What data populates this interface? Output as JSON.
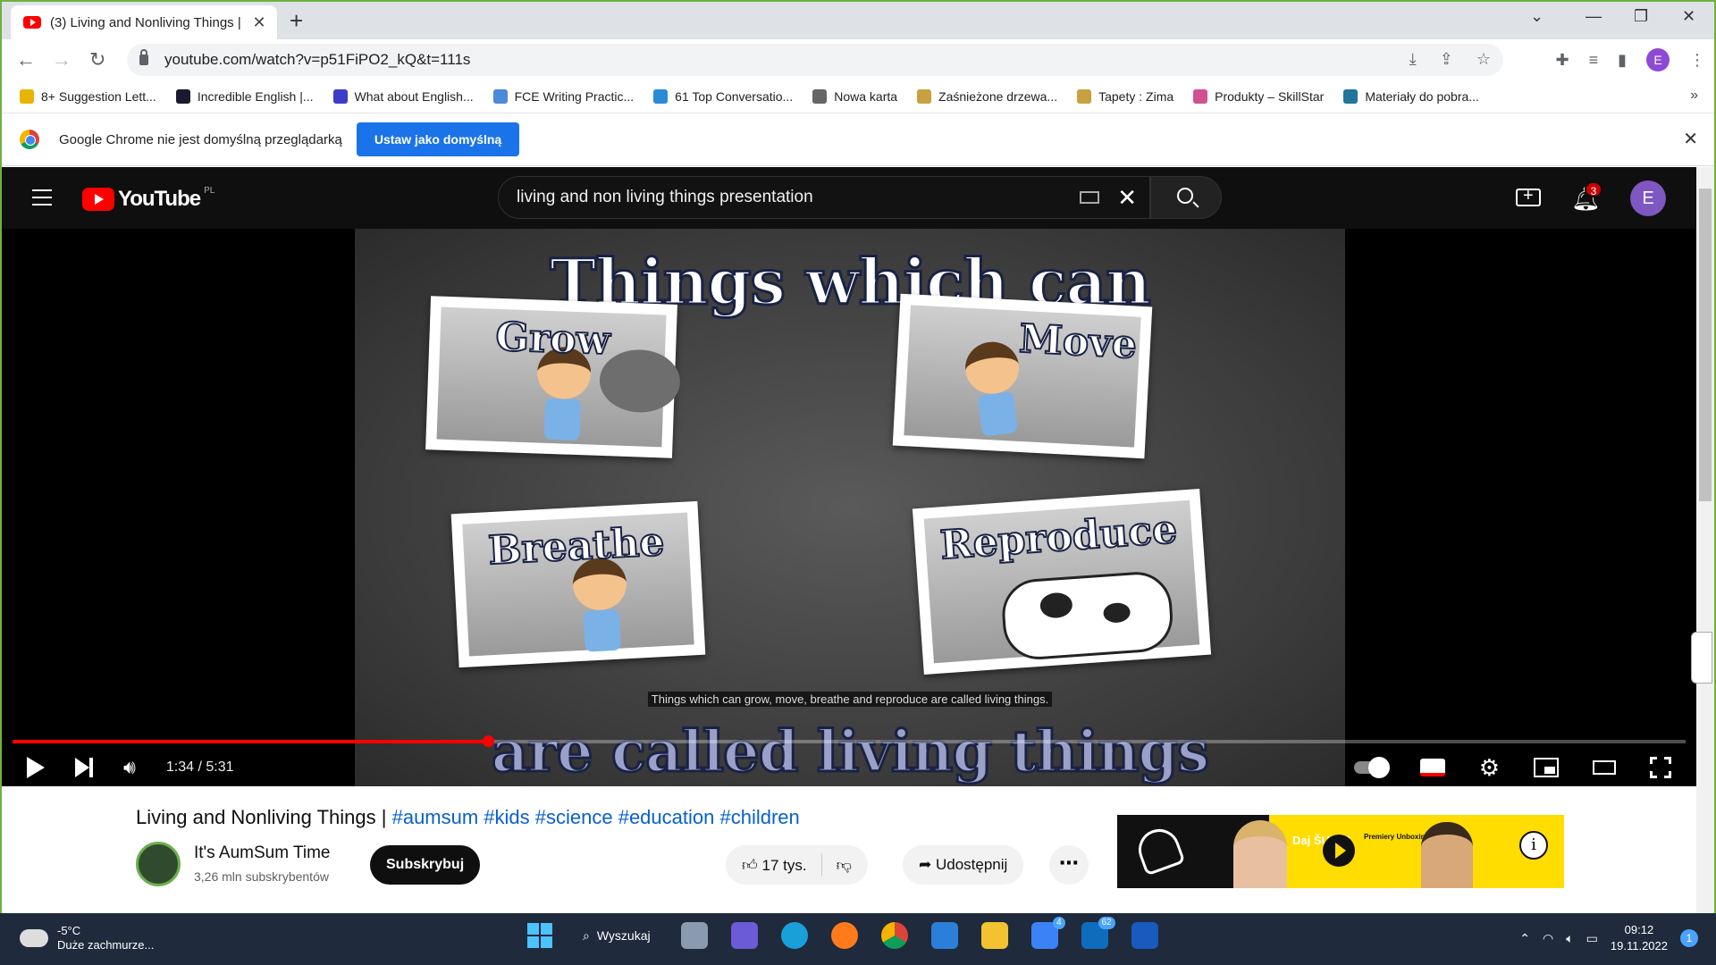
{
  "browser": {
    "tab_title": "(3) Living and Nonliving Things |",
    "url": "youtube.com/watch?v=p51FiPO2_kQ&t=111s",
    "bookmarks": [
      {
        "label": "8+ Suggestion Lett...",
        "color": "#e8b400"
      },
      {
        "label": "Incredible English |...",
        "color": "#1a1a2e"
      },
      {
        "label": "What about English...",
        "color": "#3c3cc8"
      },
      {
        "label": "FCE Writing Practic...",
        "color": "#4a8ad8"
      },
      {
        "label": "61 Top Conversatio...",
        "color": "#2a8ad8"
      },
      {
        "label": "Nowa karta",
        "color": "#666666"
      },
      {
        "label": "Zaśnieżone drzewa...",
        "color": "#c8a040"
      },
      {
        "label": "Tapety : Zima",
        "color": "#c8a040"
      },
      {
        "label": "Produkty – SkillStar",
        "color": "#d05090"
      },
      {
        "label": "Materiały do pobra...",
        "color": "#21759b"
      }
    ],
    "infobar_text": "Google Chrome nie jest domyślną przeglądarką",
    "infobar_button": "Ustaw jako domyślną",
    "profile_initial": "E"
  },
  "youtube": {
    "logo_text": "YouTube",
    "region": "PL",
    "search_query": "living and non living things presentation",
    "notification_count": "3",
    "avatar_initial": "E"
  },
  "player": {
    "time": "1:34 / 5:31",
    "progress": 0.284,
    "frame_title": "Things which can",
    "frame_cards": [
      "Grow",
      "Move",
      "Breathe",
      "Reproduce"
    ],
    "subtitle": "Things which can grow, move, breathe and reproduce are called living things.",
    "frame_bottom": "are called living things"
  },
  "video": {
    "title": "Living and Nonliving Things | ",
    "tags": "#aumsum #kids #science #education #children",
    "channel_name": "It's AumSum Time",
    "subscribers": "3,26 mln subskrybentów",
    "subscribe_label": "Subskrybuj",
    "likes": "17 tys.",
    "share_label": "Udostępnij"
  },
  "ad": {
    "daj_text": "Daj ŠUBA!",
    "promo_text": "Premiery Unboxingi Konkursy!"
  },
  "taskbar": {
    "temperature": "-5°C",
    "weather": "Duże zachmurze...",
    "search_label": "Wyszukaj",
    "todo_badge": "4",
    "mail_badge": "62",
    "time": "09:12",
    "date": "19.11.2022",
    "notif_count": "1"
  }
}
